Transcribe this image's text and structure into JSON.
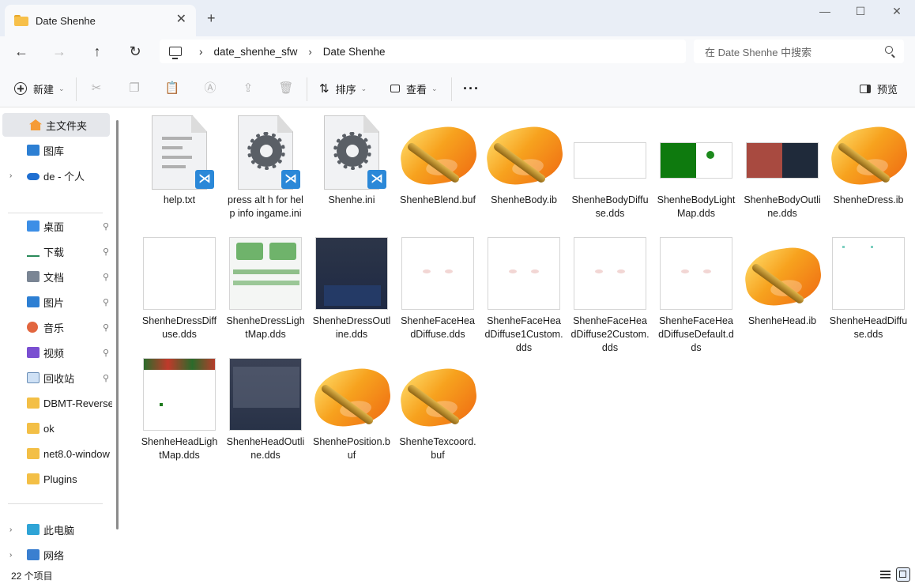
{
  "window": {
    "tab_title": "Date Shenhe",
    "tab_close": "✕",
    "new_tab": "+",
    "minimize": "—",
    "maximize": "☐",
    "close": "✕"
  },
  "nav": {
    "back": "←",
    "forward": "→",
    "up": "↑",
    "refresh": "↻",
    "breadcrumb": [
      "date_shenhe_sfw",
      "Date Shenhe"
    ],
    "separator": "›",
    "search_placeholder": "在 Date Shenhe 中搜索"
  },
  "toolbar": {
    "new_label": "新建",
    "sort_label": "排序",
    "view_label": "查看",
    "more_label": "···",
    "preview_label": "预览",
    "chevron": "⌄"
  },
  "sidebar": {
    "items": [
      {
        "label": "主文件夹",
        "icon": "home-icon"
      },
      {
        "label": "图库",
        "icon": "gallery-icon"
      },
      {
        "label": "de - 个人",
        "icon": "onedrive-icon"
      },
      {
        "label": "桌面",
        "icon": "desktop-icon"
      },
      {
        "label": "下载",
        "icon": "download-icon"
      },
      {
        "label": "文档",
        "icon": "documents-icon"
      },
      {
        "label": "图片",
        "icon": "pictures-icon"
      },
      {
        "label": "音乐",
        "icon": "music-icon"
      },
      {
        "label": "视频",
        "icon": "videos-icon"
      },
      {
        "label": "回收站",
        "icon": "recycle-bin-icon"
      },
      {
        "label": "DBMT-Reverse",
        "icon": "folder-icon"
      },
      {
        "label": "ok",
        "icon": "folder-icon"
      },
      {
        "label": "net8.0-window",
        "icon": "folder-icon"
      },
      {
        "label": "Plugins",
        "icon": "folder-icon"
      },
      {
        "label": "此电脑",
        "icon": "this-pc-icon"
      },
      {
        "label": "网络",
        "icon": "network-icon"
      }
    ],
    "expand_arrow": "›",
    "pin": "📌"
  },
  "status": {
    "item_count": "22 个项目"
  },
  "files": [
    {
      "name": "help.txt",
      "type": "txt"
    },
    {
      "name": "press alt h for help info ingame.ini",
      "type": "ini"
    },
    {
      "name": "Shenhe.ini",
      "type": "ini"
    },
    {
      "name": "ShenheBlend.buf",
      "type": "buf"
    },
    {
      "name": "ShenheBody.ib",
      "type": "buf"
    },
    {
      "name": "ShenheBodyDiffuse.dds",
      "type": "dds-blank-wide"
    },
    {
      "name": "ShenheBodyLightMap.dds",
      "type": "dds-green"
    },
    {
      "name": "ShenheBodyOutline.dds",
      "type": "dds-red-dark"
    },
    {
      "name": "ShenheDress.ib",
      "type": "buf"
    },
    {
      "name": "ShenheDressDiffuse.dds",
      "type": "dds-blank"
    },
    {
      "name": "ShenheDressLightMap.dds",
      "type": "dds-green-light"
    },
    {
      "name": "ShenheDressOutline.dds",
      "type": "dds-navy"
    },
    {
      "name": "ShenheFaceHeadDiffuse.dds",
      "type": "dds-face"
    },
    {
      "name": "ShenheFaceHeadDiffuse1Custom.dds",
      "type": "dds-face"
    },
    {
      "name": "ShenheFaceHeadDiffuse2Custom.dds",
      "type": "dds-face"
    },
    {
      "name": "ShenheFaceHeadDiffuseDefault.dds",
      "type": "dds-face"
    },
    {
      "name": "ShenheHead.ib",
      "type": "buf"
    },
    {
      "name": "ShenheHeadDiffuse.dds",
      "type": "dds-dots"
    },
    {
      "name": "ShenheHeadLightMap.dds",
      "type": "dds-head-light"
    },
    {
      "name": "ShenheHeadOutline.dds",
      "type": "dds-navy-2"
    },
    {
      "name": "ShenhePosition.buf",
      "type": "buf"
    },
    {
      "name": "ShenheTexcoord.buf",
      "type": "buf"
    }
  ]
}
